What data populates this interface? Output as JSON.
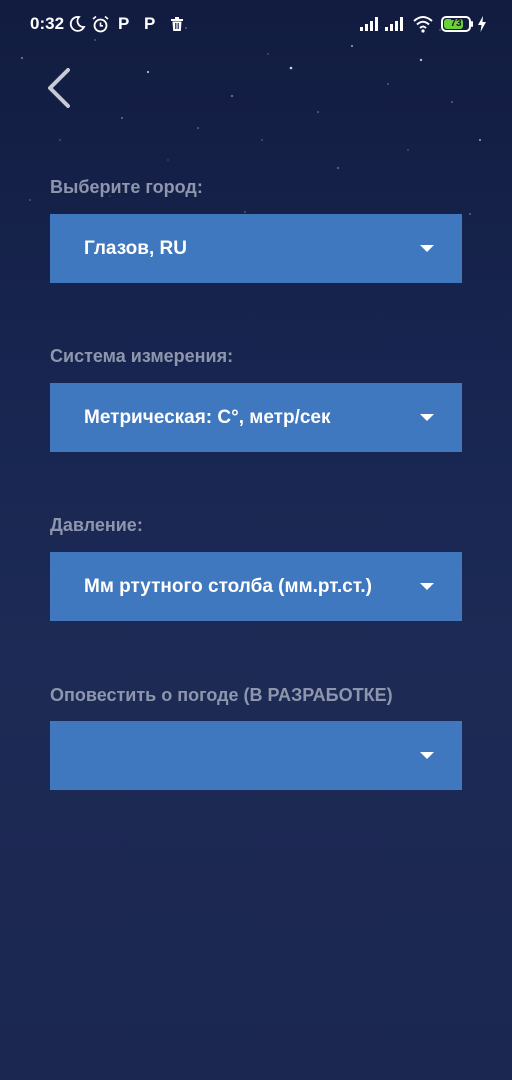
{
  "status_bar": {
    "time": "0:32",
    "p_icon_1": "P",
    "p_icon_2": "P",
    "battery_level": "73",
    "icons": [
      "moon-icon",
      "alarm-icon",
      "p-icon",
      "p-icon",
      "trash-icon",
      "signal-icon",
      "signal-icon",
      "wifi-icon",
      "battery-icon",
      "charging-icon"
    ]
  },
  "nav": {
    "back_icon": "chevron-left-icon"
  },
  "form": {
    "city": {
      "label": "Выберите город:",
      "value": "Глазов, RU"
    },
    "units": {
      "label": "Система измерения:",
      "value": "Метрическая: C°, метр/сек"
    },
    "pressure": {
      "label": "Давление:",
      "value": "Мм ртутного столба (мм.рт.ст.)"
    },
    "notify": {
      "label": "Оповестить о погоде (В РАЗРАБОТКЕ)",
      "value": ""
    }
  },
  "colors": {
    "background_top": "#121c40",
    "background_bottom": "#1b2750",
    "label": "#8e96ad",
    "dropdown": "#3f78be",
    "battery": "#6bd13a"
  }
}
